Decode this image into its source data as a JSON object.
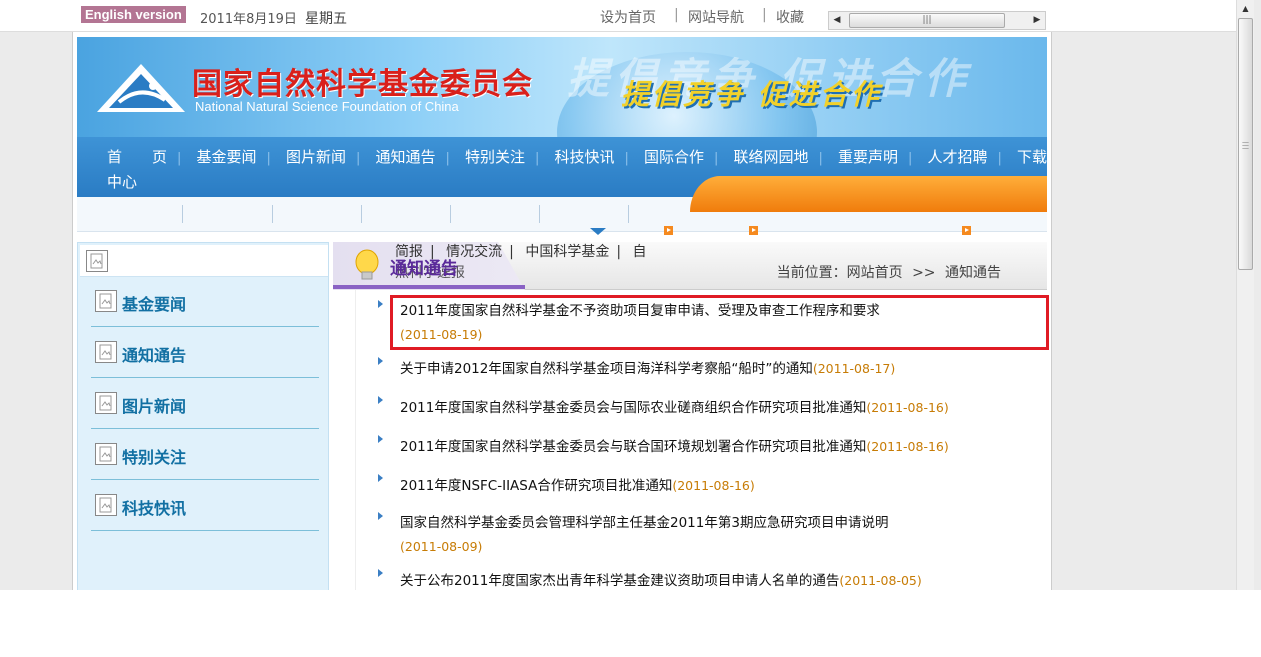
{
  "top_bar": {
    "english_version": "English version",
    "date": "2011年8月19日",
    "weekday": "星期五",
    "links": [
      "设为首页",
      "网站导航",
      "收藏"
    ]
  },
  "banner": {
    "title_cn": "国家自然科学基金委员会",
    "title_en": "National Natural Science Foundation of China",
    "slogan": "提倡竞争  促进合作",
    "watermark": "提倡竞争 促进合作"
  },
  "nav": {
    "items": [
      "首　　页",
      "基金要闻",
      "图片新闻",
      "通知通告",
      "特别关注",
      "科技快讯",
      "国际合作",
      "联络网园地",
      "重要声明",
      "人才招聘",
      "下载"
    ],
    "wrap_text": "中心"
  },
  "sidebar": {
    "items": [
      "基金要闻",
      "通知通告",
      "图片新闻",
      "特别关注",
      "科技快讯"
    ]
  },
  "main": {
    "section_title": "通知通告",
    "overlap_text": "热科学速报",
    "sub_links": [
      "简报",
      "情况交流",
      "中国科学基金",
      "自"
    ],
    "location_label": "当前位置：",
    "breadcrumb_home": "网站首页",
    "breadcrumb_sep": ">>",
    "breadcrumb_current": "通知通告",
    "notices": [
      {
        "title": "2011年度国家自然科学基金不予资助项目复审申请、受理及审查工作程序和要求",
        "date": "(2011-08-19)"
      },
      {
        "title": "关于申请2012年国家自然科学基金项目海洋科学考察船“船时”的通知",
        "date": "(2011-08-17)"
      },
      {
        "title": "2011年度国家自然科学基金委员会与国际农业磋商组织合作研究项目批准通知",
        "date": "(2011-08-16)"
      },
      {
        "title": "2011年度国家自然科学基金委员会与联合国环境规划署合作研究项目批准通知",
        "date": "(2011-08-16)"
      },
      {
        "title": "2011年度NSFC-IIASA合作研究项目批准通知",
        "date": "(2011-08-16)"
      },
      {
        "title": "国家自然科学基金委员会管理科学部主任基金2011年第3期应急研究项目申请说明",
        "date": "(2011-08-09)"
      },
      {
        "title": "关于公布2011年度国家杰出青年科学基金建议资助项目申请人名单的通告",
        "date": "(2011-08-05)"
      }
    ]
  },
  "colors": {
    "nav_blue": "#2a7cc4",
    "sidebar_text": "#1270a3",
    "date_orange": "#c77c06",
    "highlight_red": "#e01b24",
    "tab_purple": "#8a62c4"
  }
}
